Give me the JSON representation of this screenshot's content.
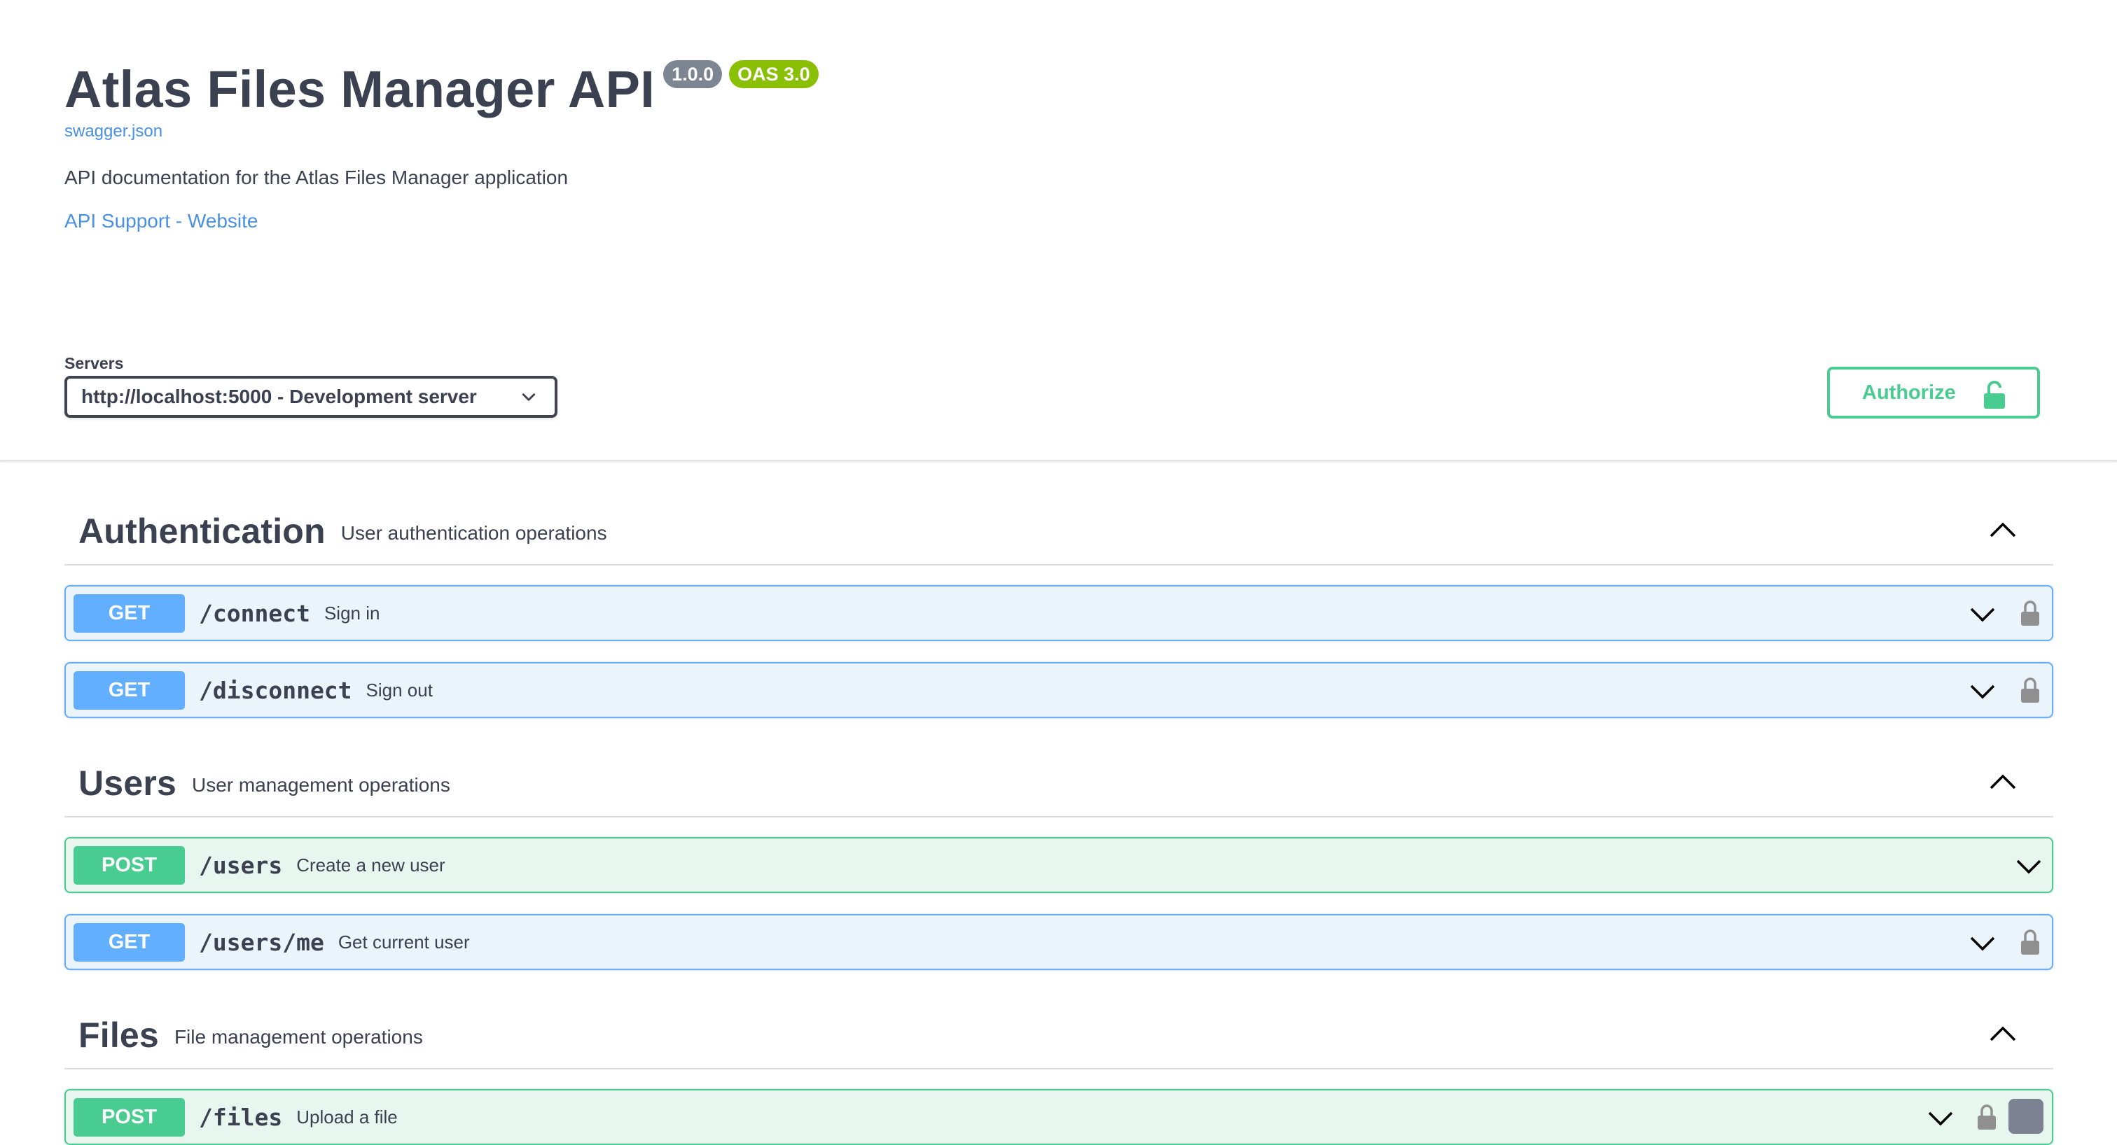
{
  "info": {
    "title": "Atlas Files Manager API",
    "version_badge": "1.0.0",
    "oas_badge": "OAS 3.0",
    "spec_link": "swagger.json",
    "description": "API documentation for the Atlas Files Manager application",
    "support_link": "API Support - Website"
  },
  "servers": {
    "label": "Servers",
    "selected": "http://localhost:5000 - Development server"
  },
  "authorize": {
    "label": "Authorize"
  },
  "colors": {
    "get": "#61affe",
    "post": "#49cc90",
    "link": "#4990e2",
    "text": "#3b4151"
  },
  "tags": [
    {
      "name": "Authentication",
      "description": "User authentication operations",
      "operations": [
        {
          "method": "GET",
          "path": "/connect",
          "summary": "Sign in",
          "locked": true
        },
        {
          "method": "GET",
          "path": "/disconnect",
          "summary": "Sign out",
          "locked": true
        }
      ]
    },
    {
      "name": "Users",
      "description": "User management operations",
      "operations": [
        {
          "method": "POST",
          "path": "/users",
          "summary": "Create a new user",
          "locked": false
        },
        {
          "method": "GET",
          "path": "/users/me",
          "summary": "Get current user",
          "locked": true
        }
      ]
    },
    {
      "name": "Files",
      "description": "File management operations",
      "operations": [
        {
          "method": "POST",
          "path": "/files",
          "summary": "Upload a file",
          "locked": true
        }
      ]
    }
  ]
}
